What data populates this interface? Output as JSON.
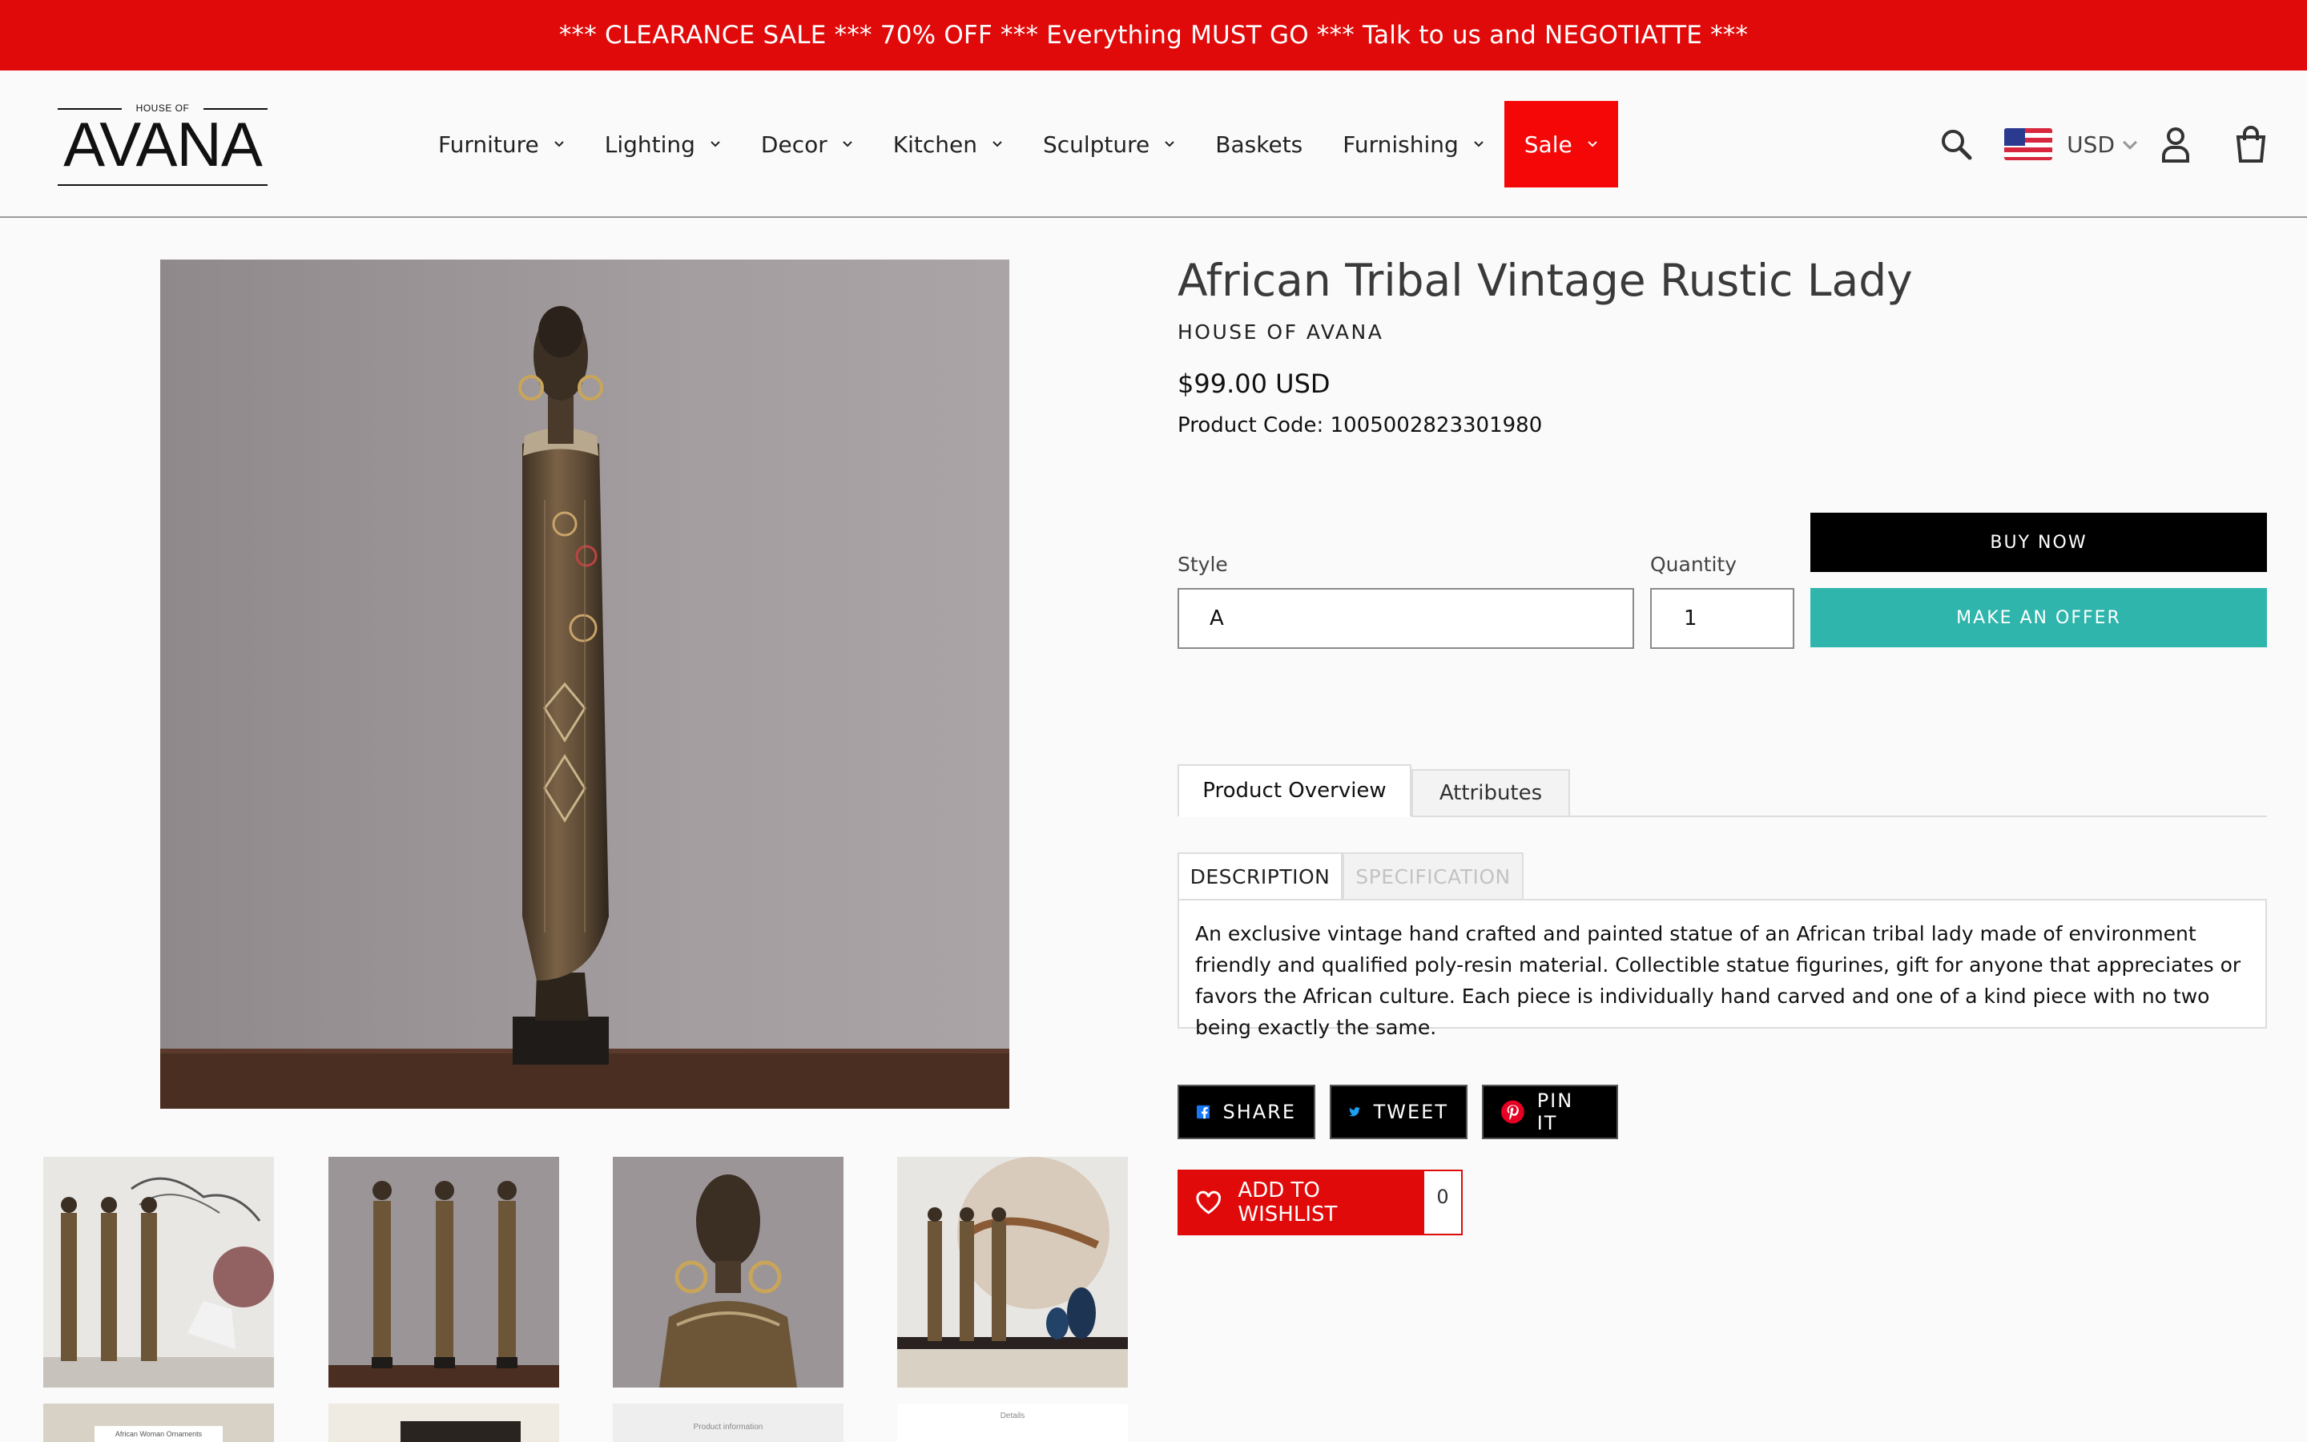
{
  "announcement": "*** CLEARANCE SALE *** 70% OFF *** Everything MUST GO *** Talk to us and NEGOTIATTE ***",
  "logo": {
    "top": "HOUSE OF",
    "main": "AVANA"
  },
  "nav": {
    "items": [
      {
        "label": "Furniture",
        "has_dropdown": true
      },
      {
        "label": "Lighting",
        "has_dropdown": true
      },
      {
        "label": "Decor",
        "has_dropdown": true
      },
      {
        "label": "Kitchen",
        "has_dropdown": true
      },
      {
        "label": "Sculpture",
        "has_dropdown": true
      },
      {
        "label": "Baskets",
        "has_dropdown": false
      },
      {
        "label": "Furnishing",
        "has_dropdown": true
      },
      {
        "label": "Sale",
        "has_dropdown": true
      }
    ],
    "sale_color": "#f50707"
  },
  "header_icons": {
    "search": "search-icon",
    "currency": "USD",
    "account": "account-icon",
    "cart": "cart-icon"
  },
  "product": {
    "title": "African Tribal Vintage Rustic Lady",
    "vendor": "HOUSE OF AVANA",
    "price": "$99.00 USD",
    "code": "Product Code: 1005002823301980",
    "style_label": "Style",
    "style_value": "A",
    "quantity_label": "Quantity",
    "quantity_value": "1",
    "buy_now": "BUY NOW",
    "make_offer": "MAKE AN OFFER"
  },
  "tabs": [
    {
      "label": "Product Overview",
      "active": true
    },
    {
      "label": "Attributes",
      "active": false
    }
  ],
  "subtabs": [
    {
      "label": "DESCRIPTION",
      "active": true
    },
    {
      "label": "SPECIFICATION",
      "active": false
    }
  ],
  "description": "An exclusive vintage hand crafted and painted statue of an African tribal lady made of environment friendly and qualified poly-resin material. Collectible statue figurines, gift for anyone that appreciates or favors the African culture. Each piece is individually hand carved and one of a kind piece with no two being exactly the same.",
  "social": {
    "share": "SHARE",
    "tweet": "TWEET",
    "pin": "PIN IT"
  },
  "wishlist": {
    "label": "ADD TO WISHLIST",
    "count": "0"
  },
  "thumbnail_captions": {
    "t5": "African Woman Ornaments",
    "t7": "Product information",
    "t8": "Details"
  },
  "colors": {
    "accent_red": "#e10a0a",
    "offer_teal": "#2fb5ac",
    "facebook": "#1877f2",
    "twitter": "#1da1f2",
    "pinterest": "#e60023"
  }
}
